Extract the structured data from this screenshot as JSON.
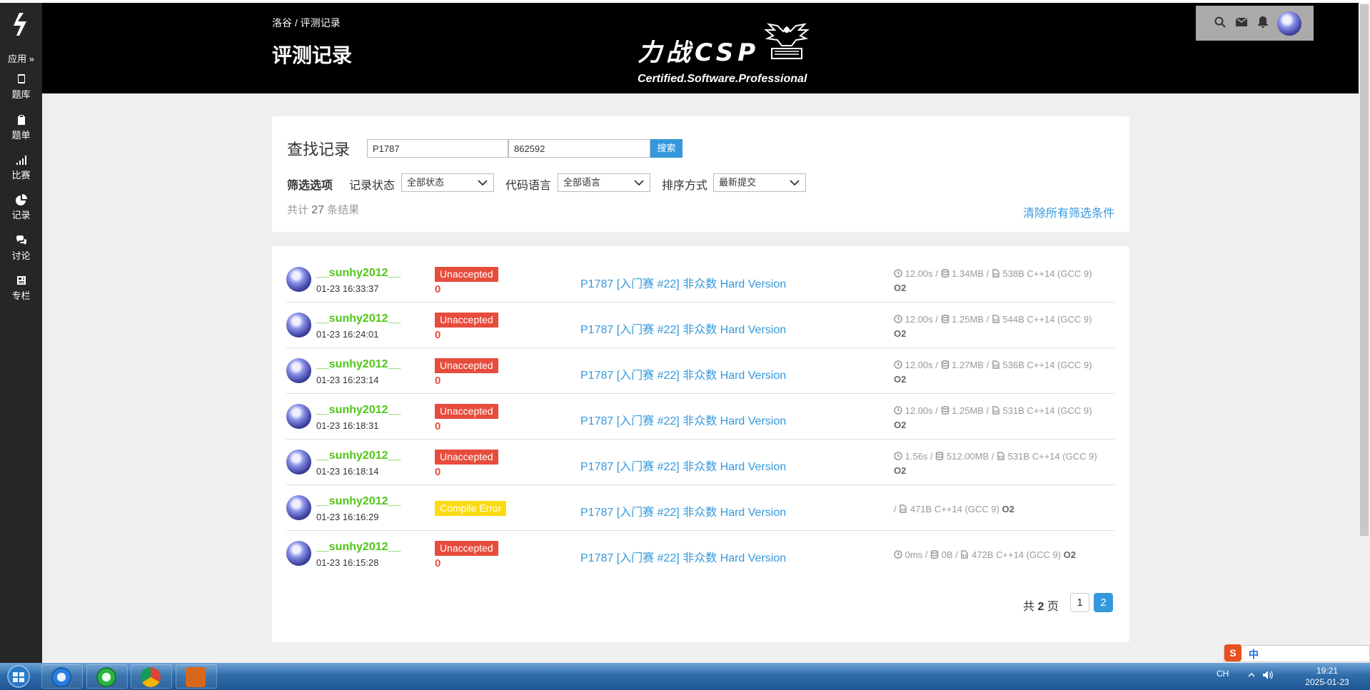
{
  "sidebar": {
    "apps_label": "应用 »",
    "items": [
      {
        "label": "题库",
        "icon": "book-icon"
      },
      {
        "label": "题单",
        "icon": "clipboard-icon"
      },
      {
        "label": "比赛",
        "icon": "signal-bars-icon"
      },
      {
        "label": "记录",
        "icon": "pie-chart-icon"
      },
      {
        "label": "讨论",
        "icon": "chat-bubbles-icon"
      },
      {
        "label": "专栏",
        "icon": "newspaper-icon"
      }
    ]
  },
  "header": {
    "breadcrumb": "洛谷 / 评测记录",
    "title": "评测记录",
    "banner_title": "力战CSP",
    "banner_subtitle": "Certified.Software.Professional"
  },
  "search": {
    "label": "查找记录",
    "problem_value": "P1787",
    "user_value": "862592",
    "button_label": "搜索"
  },
  "filters": {
    "title": "筛选选项",
    "status_label": "记录状态",
    "status_value": "全部状态",
    "lang_label": "代码语言",
    "lang_value": "全部语言",
    "order_label": "排序方式",
    "order_value": "最新提交"
  },
  "summary": {
    "prefix": "共计",
    "count": "27",
    "suffix": "条结果",
    "clear_label": "清除所有筛选条件"
  },
  "records": [
    {
      "user": "__sunhy2012__",
      "time": "01-23 16:33:37",
      "status": "Unaccepted",
      "status_type": "ua",
      "score": "0",
      "problem": "P1787 [入门赛 #22] 非众数 Hard Version",
      "runtime": "12.00s",
      "memory": "1.34MB",
      "code": "538B C++14 (GCC 9)",
      "opt": "O2"
    },
    {
      "user": "__sunhy2012__",
      "time": "01-23 16:24:01",
      "status": "Unaccepted",
      "status_type": "ua",
      "score": "0",
      "problem": "P1787 [入门赛 #22] 非众数 Hard Version",
      "runtime": "12.00s",
      "memory": "1.25MB",
      "code": "544B C++14 (GCC 9)",
      "opt": "O2"
    },
    {
      "user": "__sunhy2012__",
      "time": "01-23 16:23:14",
      "status": "Unaccepted",
      "status_type": "ua",
      "score": "0",
      "problem": "P1787 [入门赛 #22] 非众数 Hard Version",
      "runtime": "12.00s",
      "memory": "1.27MB",
      "code": "536B C++14 (GCC 9)",
      "opt": "O2"
    },
    {
      "user": "__sunhy2012__",
      "time": "01-23 16:18:31",
      "status": "Unaccepted",
      "status_type": "ua",
      "score": "0",
      "problem": "P1787 [入门赛 #22] 非众数 Hard Version",
      "runtime": "12.00s",
      "memory": "1.25MB",
      "code": "531B C++14 (GCC 9)",
      "opt": "O2"
    },
    {
      "user": "__sunhy2012__",
      "time": "01-23 16:18:14",
      "status": "Unaccepted",
      "status_type": "ua",
      "score": "0",
      "problem": "P1787 [入门赛 #22] 非众数 Hard Version",
      "runtime": "1.56s",
      "memory": "512.00MB",
      "code": "531B C++14 (GCC 9)",
      "opt": "O2"
    },
    {
      "user": "__sunhy2012__",
      "time": "01-23 16:16:29",
      "status": "Compile Error",
      "status_type": "ce",
      "score": "",
      "problem": "P1787 [入门赛 #22] 非众数 Hard Version",
      "runtime": "",
      "memory": "",
      "code": "471B C++14 (GCC 9)",
      "opt": "O2"
    },
    {
      "user": "__sunhy2012__",
      "time": "01-23 16:15:28",
      "status": "Unaccepted",
      "status_type": "ua",
      "score": "0",
      "problem": "P1787 [入门赛 #22] 非众数 Hard Version",
      "runtime": "0ms",
      "memory": "0B",
      "code": "472B C++14 (GCC 9)",
      "opt": "O2"
    }
  ],
  "pager": {
    "prefix": "共",
    "total": "2",
    "suffix": "页",
    "pages": [
      "1",
      "2"
    ],
    "current": "2"
  },
  "taskbar": {
    "apps": [
      "ie-icon",
      "ie-green-icon",
      "chrome-icon",
      "devcpp-icon"
    ],
    "tray_lang": "CH",
    "time": "19:21",
    "date": "2025-01-23",
    "ime_label": "中"
  },
  "colors": {
    "accent": "#3498db",
    "unaccepted": "#e74c3c",
    "compile_error": "#fadb14",
    "username": "#52c41a",
    "sidebar": "#262626",
    "header": "#000000"
  }
}
